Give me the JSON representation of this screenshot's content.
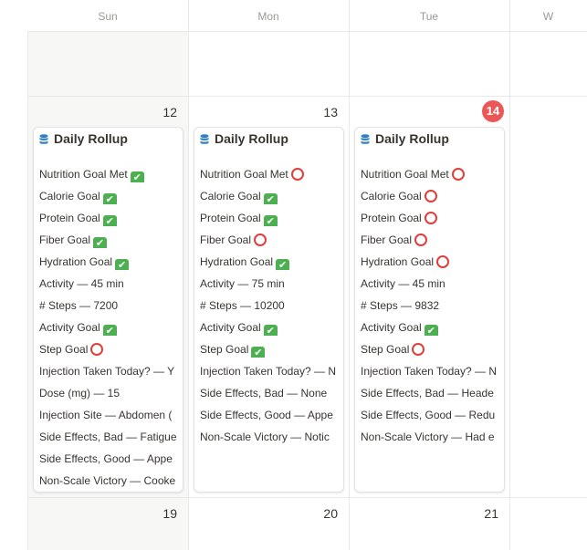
{
  "days_of_week": [
    "Sun",
    "Mon",
    "Tue",
    "W"
  ],
  "weeks": [
    {
      "days": [
        "",
        "",
        "",
        ""
      ]
    },
    {
      "days": [
        "12",
        "13",
        "14",
        ""
      ]
    },
    {
      "days": [
        "19",
        "20",
        "21",
        ""
      ]
    }
  ],
  "today": "14",
  "colors": {
    "accent_red": "#eb5757",
    "check_green": "#4caf50",
    "ring_red": "#e03e3e"
  },
  "cards": [
    {
      "day": "12",
      "title": "Daily Rollup",
      "icon": "database-icon",
      "properties": [
        {
          "text": "Nutrition Goal Met",
          "status": "check"
        },
        {
          "text": "Calorie Goal",
          "status": "check"
        },
        {
          "text": "Protein Goal",
          "status": "check"
        },
        {
          "text": "Fiber Goal",
          "status": "check"
        },
        {
          "text": "Hydration Goal",
          "status": "check"
        },
        {
          "text": "Activity — 45 min",
          "status": ""
        },
        {
          "text": "# Steps — 7200",
          "status": ""
        },
        {
          "text": "Activity Goal",
          "status": "check"
        },
        {
          "text": "Step Goal",
          "status": "ring"
        },
        {
          "text": "Injection Taken Today? — Y",
          "status": ""
        },
        {
          "text": "Dose (mg) — 15",
          "status": ""
        },
        {
          "text": "Injection Site — Abdomen (",
          "status": ""
        },
        {
          "text": "Side Effects, Bad — Fatigue",
          "status": ""
        },
        {
          "text": "Side Effects, Good — Appe",
          "status": ""
        },
        {
          "text": "Non-Scale Victory — Cooke",
          "status": ""
        }
      ]
    },
    {
      "day": "13",
      "title": "Daily Rollup",
      "icon": "database-icon",
      "properties": [
        {
          "text": "Nutrition Goal Met",
          "status": "ring"
        },
        {
          "text": "Calorie Goal",
          "status": "check"
        },
        {
          "text": "Protein Goal",
          "status": "check"
        },
        {
          "text": "Fiber Goal",
          "status": "ring"
        },
        {
          "text": "Hydration Goal",
          "status": "check"
        },
        {
          "text": "Activity — 75 min",
          "status": ""
        },
        {
          "text": "# Steps — 10200",
          "status": ""
        },
        {
          "text": "Activity Goal",
          "status": "check"
        },
        {
          "text": "Step Goal",
          "status": "check"
        },
        {
          "text": "Injection Taken Today? — N",
          "status": ""
        },
        {
          "text": "Side Effects, Bad — None",
          "status": ""
        },
        {
          "text": "Side Effects, Good — Appe",
          "status": ""
        },
        {
          "text": "Non-Scale Victory — Notic",
          "status": ""
        }
      ]
    },
    {
      "day": "14",
      "title": "Daily Rollup",
      "icon": "database-icon",
      "properties": [
        {
          "text": "Nutrition Goal Met",
          "status": "ring"
        },
        {
          "text": "Calorie Goal",
          "status": "ring"
        },
        {
          "text": "Protein Goal",
          "status": "ring"
        },
        {
          "text": "Fiber Goal",
          "status": "ring"
        },
        {
          "text": "Hydration Goal",
          "status": "ring"
        },
        {
          "text": "Activity — 45 min",
          "status": ""
        },
        {
          "text": "# Steps — 9832",
          "status": ""
        },
        {
          "text": "Activity Goal",
          "status": "check"
        },
        {
          "text": "Step Goal",
          "status": "ring"
        },
        {
          "text": "Injection Taken Today? — N",
          "status": ""
        },
        {
          "text": "Side Effects, Bad — Heade",
          "status": ""
        },
        {
          "text": "Side Effects, Good — Redu",
          "status": ""
        },
        {
          "text": "Non-Scale Victory — Had e",
          "status": ""
        }
      ]
    }
  ]
}
